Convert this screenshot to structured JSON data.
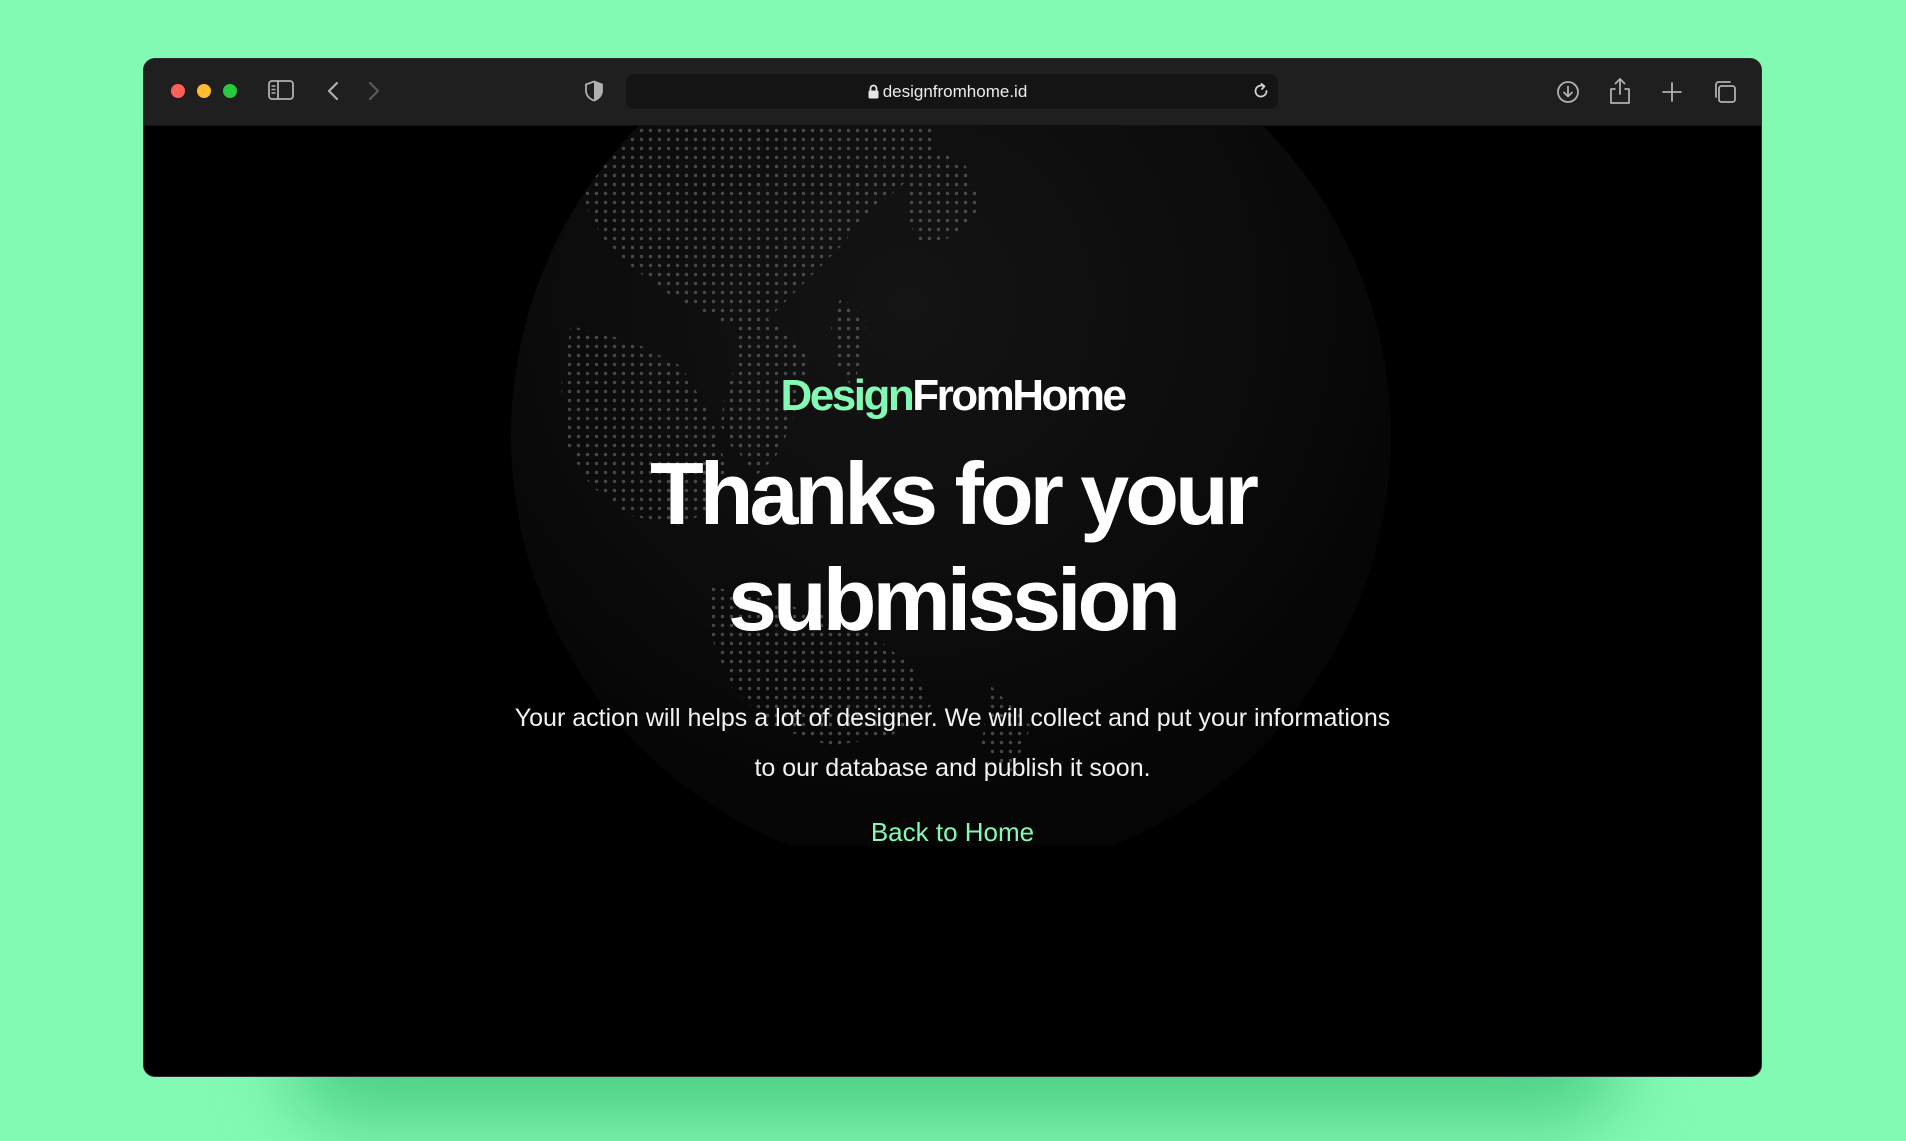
{
  "browser": {
    "url": "designfromhome.id"
  },
  "page": {
    "logo_part1": "Design",
    "logo_part2": "FromHome",
    "headline_line1": "Thanks for your",
    "headline_line2": "submission",
    "body_line1": "Your action will helps a lot of designer. We will collect and put your informations",
    "body_line2": "to our database and publish it soon.",
    "back_link": "Back to Home"
  },
  "colors": {
    "background": "#83fab4",
    "accent": "#83fab4",
    "page_bg": "#000000",
    "toolbar_bg": "#1f1f1f"
  }
}
